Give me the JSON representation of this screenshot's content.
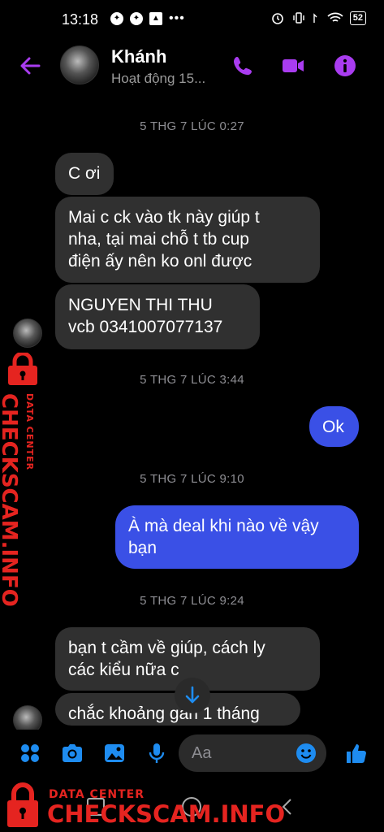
{
  "status_bar": {
    "time": "13:18",
    "dots": "•••",
    "battery": "52"
  },
  "header": {
    "contact_name": "Khánh",
    "contact_status": "Hoạt động 15..."
  },
  "messages": [
    {
      "type": "timestamp",
      "text": "5 THG 7 LÚC 0:27"
    },
    {
      "type": "in",
      "text": "C ơi"
    },
    {
      "type": "in",
      "lines": [
        "Mai c ck vào tk này giúp t",
        "nha, tại mai chỗ t tb cup",
        "điện ấy nên ko onl được"
      ]
    },
    {
      "type": "in",
      "lines": [
        "NGUYEN THI THU",
        "vcb 0341007077137"
      ]
    },
    {
      "type": "timestamp",
      "text": "5 THG 7 LÚC 3:44"
    },
    {
      "type": "out",
      "text": "Ok"
    },
    {
      "type": "timestamp",
      "text": "5 THG 7 LÚC 9:10"
    },
    {
      "type": "out",
      "lines": [
        "À mà deal khi nào về vậy",
        "bạn"
      ]
    },
    {
      "type": "timestamp",
      "text": "5 THG 7 LÚC 9:24"
    },
    {
      "type": "in",
      "lines": [
        "bạn t cầm về giúp, cách ly",
        "các kiểu nữa c"
      ]
    },
    {
      "type": "in",
      "text": "chắc khoảng gần 1 tháng"
    }
  ],
  "composer": {
    "placeholder": "Aa"
  },
  "watermark": {
    "line1": "DATA CENTER",
    "line2": "CHECKSCAM.INFO"
  },
  "colors": {
    "accent": "#a93cf0",
    "outgoing_bubble": "#3a50e6",
    "incoming_bubble": "#303030",
    "composer_icons": "#1e8cf0",
    "watermark": "#e52420"
  }
}
